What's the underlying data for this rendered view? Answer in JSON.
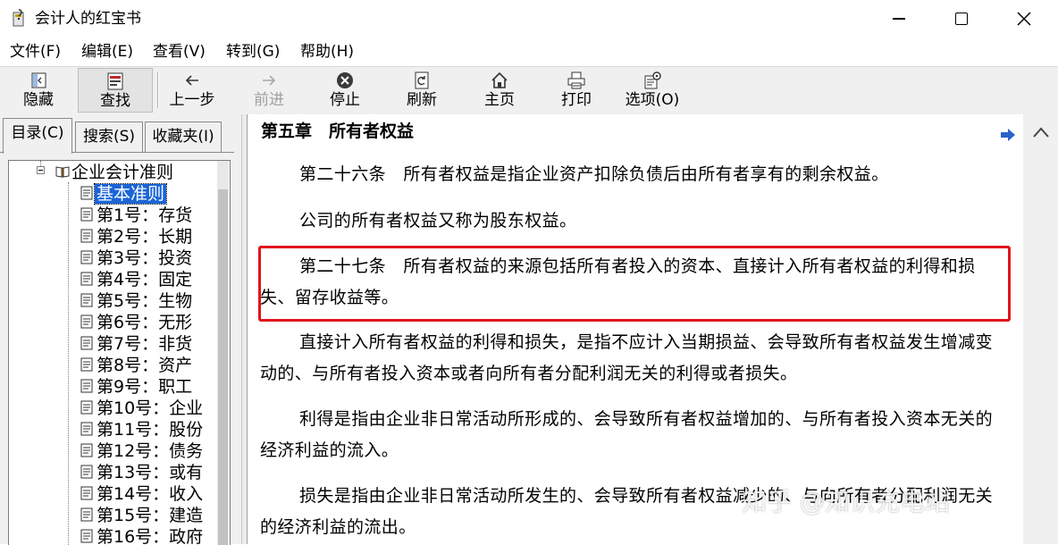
{
  "window": {
    "title": "会计人的红宝书"
  },
  "menu": [
    "文件(F)",
    "编辑(E)",
    "查看(V)",
    "转到(G)",
    "帮助(H)"
  ],
  "toolbar": {
    "hide": "隐藏",
    "find": "查找",
    "back": "上一步",
    "forward": "前进",
    "stop": "停止",
    "refresh": "刷新",
    "home": "主页",
    "print": "打印",
    "options": "选项(O)"
  },
  "tabs": {
    "contents": "目录(C)",
    "search": "搜索(S)",
    "favorites": "收藏夹(I)"
  },
  "tree": {
    "root": "企业会计准则",
    "selected": "基本准则",
    "items": [
      "第1号：存货",
      "第2号：长期",
      "第3号：投资",
      "第4号：固定",
      "第5号：生物",
      "第6号：无形",
      "第7号：非货",
      "第8号：资产",
      "第9号：职工",
      "第10号：企业",
      "第11号：股份",
      "第12号：债务",
      "第13号：或有",
      "第14号：收入",
      "第15号：建造",
      "第16号：政府"
    ]
  },
  "content": {
    "chapter": "第五章　所有者权益",
    "paragraphs": [
      "第二十六条　所有者权益是指企业资产扣除负债后由所有者享有的剩余权益。",
      "公司的所有者权益又称为股东权益。",
      "第二十七条　所有者权益的来源包括所有者投入的资本、直接计入所有者权益的利得和损失、留存收益等。",
      "直接计入所有者权益的利得和损失，是指不应计入当期损益、会导致所有者权益发生增减变动的、与所有者投入资本或者向所有者分配利润无关的利得或者损失。",
      "利得是指由企业非日常活动所形成的、会导致所有者权益增加的、与所有者投入资本无关的经济利益的流入。",
      "损失是指由企业非日常活动所发生的、会导致所有者权益减少的、与向所有者分配利润无关的经济利益的流出。"
    ],
    "highlight_color": "#e0141c"
  },
  "watermark": "知乎 @知识充电站"
}
